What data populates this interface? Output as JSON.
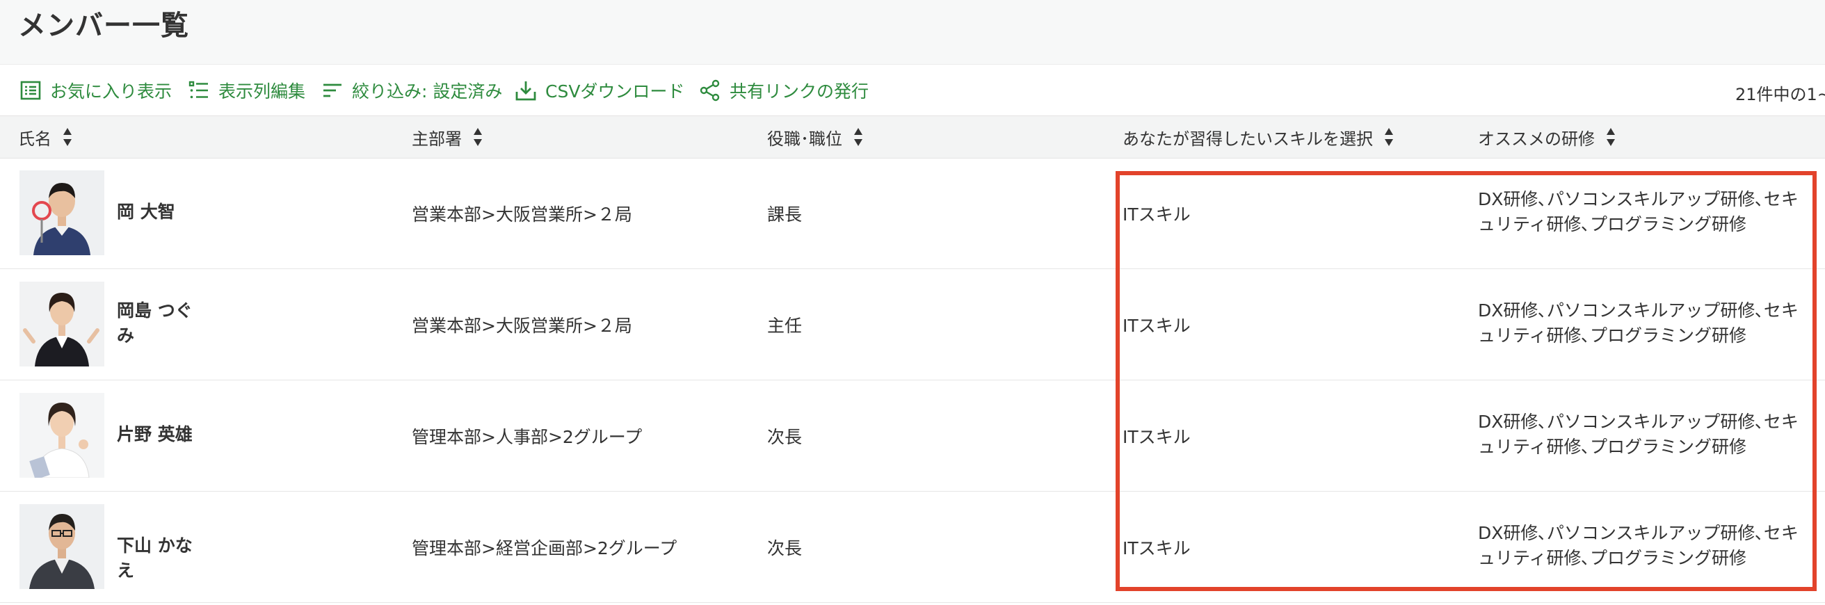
{
  "page": {
    "title": "メンバー一覧"
  },
  "toolbar": {
    "favorites": "お気に入り表示",
    "edit_columns": "表示列編集",
    "filter": "絞り込み: 設定済み",
    "csv": "CSVダウンロード",
    "share": "共有リンクの発行",
    "count": "21件中の1~"
  },
  "columns": {
    "name": "氏名",
    "department": "主部署",
    "position": "役職･職位",
    "skill": "あなたが習得したいスキルを選択",
    "training": "オススメの研修"
  },
  "rows": [
    {
      "name": "岡 大智",
      "department": "営業本部>大阪営業所>２局",
      "position": "課長",
      "skill": "ITスキル",
      "training": "DX研修､パソコンスキルアップ研修､セキュリティ研修､プログラミング研修"
    },
    {
      "name": "岡島 つぐみ",
      "department": "営業本部>大阪営業所>２局",
      "position": "主任",
      "skill": "ITスキル",
      "training": "DX研修､パソコンスキルアップ研修､セキュリティ研修､プログラミング研修"
    },
    {
      "name": "片野 英雄",
      "department": "管理本部>人事部>2グループ",
      "position": "次長",
      "skill": "ITスキル",
      "training": "DX研修､パソコンスキルアップ研修､セキュリティ研修､プログラミング研修"
    },
    {
      "name": "下山 かなえ",
      "department": "管理本部>経営企画部>2グループ",
      "position": "次長",
      "skill": "ITスキル",
      "training": "DX研修､パソコンスキルアップ研修､セキュリティ研修､プログラミング研修"
    }
  ],
  "colors": {
    "accent": "#2e8b3e",
    "highlight": "#e2432b",
    "header_bg": "#f3f4f4"
  },
  "icons": [
    "list-icon",
    "columns-icon",
    "filter-icon",
    "download-icon",
    "share-icon",
    "sort-icon"
  ]
}
